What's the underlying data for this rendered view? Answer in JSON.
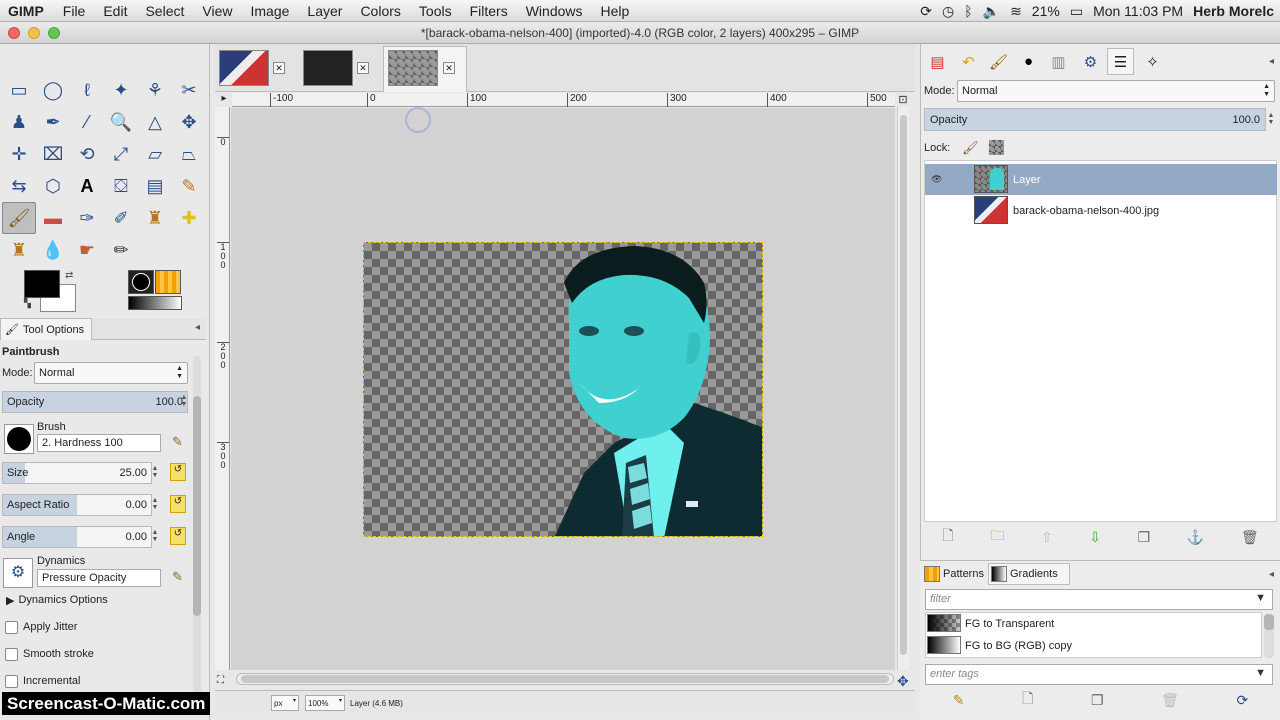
{
  "menubar": {
    "app": "GIMP",
    "items": [
      "File",
      "Edit",
      "Select",
      "View",
      "Image",
      "Layer",
      "Colors",
      "Tools",
      "Filters",
      "Windows",
      "Help"
    ],
    "battery": "21%",
    "clock": "Mon 11:03 PM",
    "user": "Herb Morelc"
  },
  "window": {
    "title": "*[barack-obama-nelson-400] (imported)-4.0 (RGB color, 2 layers) 400x295 – GIMP"
  },
  "toolbox": {
    "tool_options_tab": "Tool Options",
    "tool_name": "Paintbrush",
    "mode_label": "Mode:",
    "mode_value": "Normal",
    "opacity_label": "Opacity",
    "opacity_value": "100.0",
    "brush_label": "Brush",
    "brush_value": "2. Hardness 100",
    "size_label": "Size",
    "size_value": "25.00",
    "aspect_label": "Aspect Ratio",
    "aspect_value": "0.00",
    "angle_label": "Angle",
    "angle_value": "0.00",
    "dynamics_label": "Dynamics",
    "dynamics_value": "Pressure Opacity",
    "dynamics_options": "Dynamics Options",
    "apply_jitter": "Apply Jitter",
    "smooth_stroke": "Smooth stroke",
    "incremental": "Incremental"
  },
  "canvas": {
    "ruler_marks": [
      "-100",
      "0",
      "100",
      "200",
      "300",
      "400",
      "500"
    ],
    "vruler_marks": [
      "0",
      "1\n0\n0",
      "2\n0\n0",
      "3\n0\n0"
    ],
    "unit": "px",
    "zoom": "100%",
    "status": "Layer (4.6 MB)"
  },
  "layers": {
    "mode_label": "Mode:",
    "mode_value": "Normal",
    "opacity_label": "Opacity",
    "opacity_value": "100.0",
    "lock_label": "Lock:",
    "items": [
      "Layer",
      "barack-obama-nelson-400.jpg"
    ]
  },
  "patterns": {
    "tab_patterns": "Patterns",
    "tab_gradients": "Gradients",
    "filter_placeholder": "filter",
    "tags_placeholder": "enter tags",
    "gradients": [
      "FG to Transparent",
      "FG to BG (RGB) copy"
    ]
  },
  "watermark": "Screencast-O-Matic.com"
}
